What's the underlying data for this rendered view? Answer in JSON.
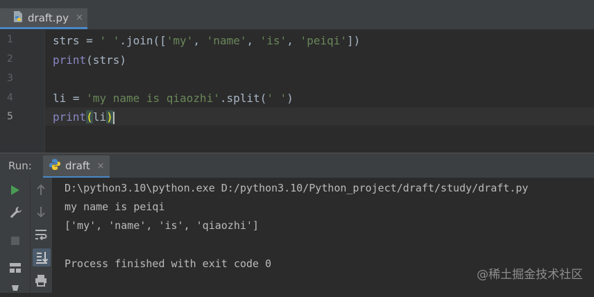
{
  "editor_tab": {
    "label": "draft.py",
    "close": "×",
    "icon": "python-file-icon"
  },
  "editor": {
    "line_numbers": [
      "1",
      "2",
      "3",
      "4",
      "5"
    ],
    "current_line": 5,
    "lines": {
      "l1": {
        "a": "strs = ",
        "b": "' '",
        "c": ".join([",
        "d": "'my'",
        "e": ", ",
        "f": "'name'",
        "g": ", ",
        "h": "'is'",
        "i": ", ",
        "j": "'peiqi'",
        "k": "])"
      },
      "l2": {
        "a": "print",
        "b": "(strs)"
      },
      "l3": {
        "a": ""
      },
      "l4": {
        "a": "li = ",
        "b": "'my name is qiaozhi'",
        "c": ".split(",
        "d": "' '",
        "e": ")"
      },
      "l5": {
        "a": "print",
        "b": "(",
        "c": "li",
        "d": ")"
      }
    }
  },
  "run_panel": {
    "title": "Run:",
    "tab_label": "draft",
    "tab_close": "×",
    "output": [
      "D:\\python3.10\\python.exe D:/python3.10/Python_project/draft/study/draft.py",
      "my name is peiqi",
      "['my', 'name', 'is', 'qiaozhi']",
      "",
      "Process finished with exit code 0"
    ]
  },
  "watermark": "@稀土掘金技术社区",
  "colors": {
    "background": "#2b2b2b",
    "string": "#6a8759",
    "builtin": "#8888c6",
    "code": "#a9b7c6",
    "accent": "#4a88c7",
    "run_green": "#499c54"
  }
}
